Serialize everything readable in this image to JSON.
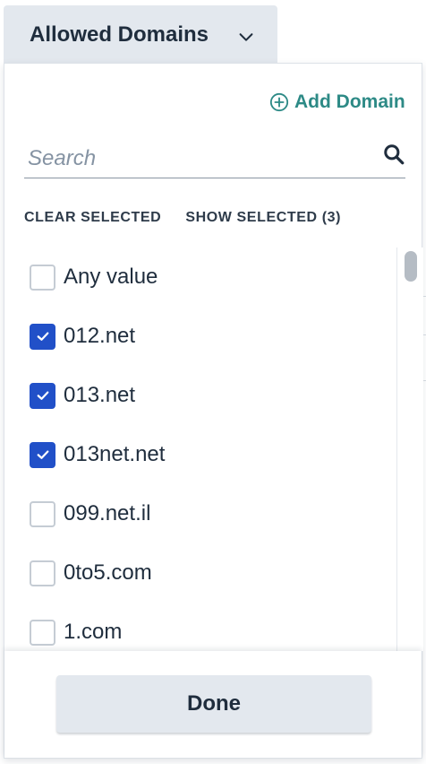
{
  "trigger": {
    "label": "Allowed Domains",
    "icon": "chevron-down-icon"
  },
  "panel": {
    "add_domain": {
      "label": "Add Domain",
      "icon": "plus-circle-icon",
      "color": "#2d8a86"
    },
    "search": {
      "placeholder": "Search",
      "value": "",
      "icon": "search-icon"
    },
    "actions": {
      "clear_label": "CLEAR SELECTED",
      "show_label": "SHOW SELECTED (3)"
    },
    "items": [
      {
        "label": "Any value",
        "checked": false
      },
      {
        "label": "012.net",
        "checked": true
      },
      {
        "label": "013.net",
        "checked": true
      },
      {
        "label": "013net.net",
        "checked": true
      },
      {
        "label": "099.net.il",
        "checked": false
      },
      {
        "label": "0to5.com",
        "checked": false
      },
      {
        "label": "1.com",
        "checked": false
      }
    ],
    "done_label": "Done"
  },
  "colors": {
    "checkbox_checked": "#2150c8",
    "accent": "#2d8a86",
    "button_bg": "#e3e8ee"
  }
}
